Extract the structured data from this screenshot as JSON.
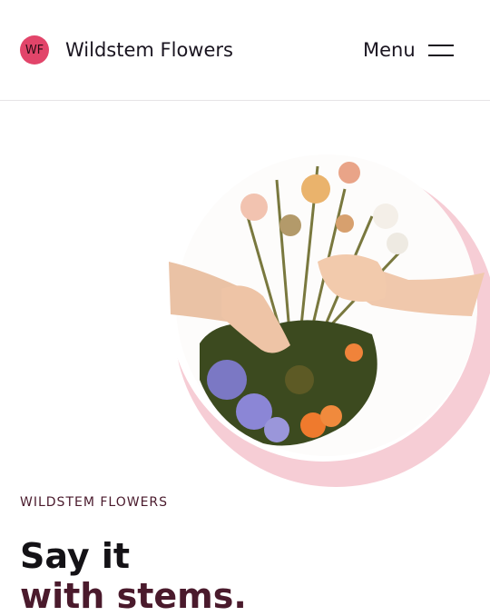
{
  "header": {
    "logo_initials": "WF",
    "brand_name": "Wildstem Flowers",
    "menu_label": "Menu"
  },
  "hero": {
    "image_alt": "Hands passing a wildflower bouquet",
    "eyebrow": "WILDSTEM FLOWERS",
    "headline_line1": "Say it",
    "headline_line2": "with stems."
  },
  "colors": {
    "accent": "#e2456a",
    "accent_ring": "#f6cdd5",
    "plum": "#4a1a2c",
    "ink": "#151218"
  },
  "icons": {
    "menu": "hamburger-menu-icon"
  }
}
